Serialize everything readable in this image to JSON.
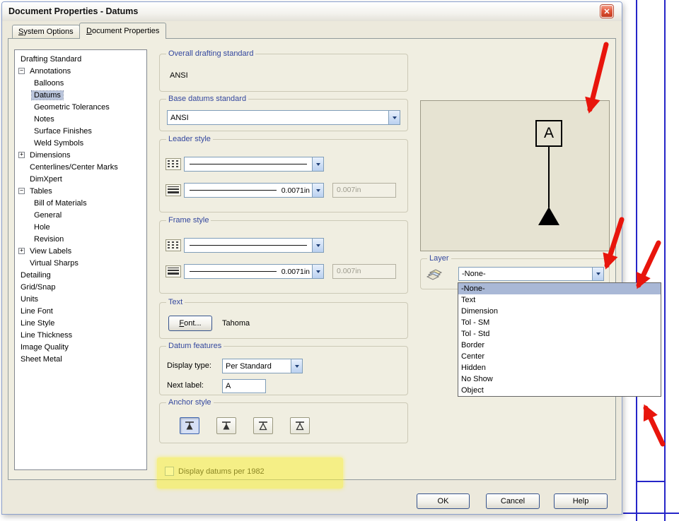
{
  "window": {
    "title": "Document Properties - Datums"
  },
  "icons": {
    "close_glyph": "✕",
    "expander_minus": "−",
    "expander_plus": "+"
  },
  "tabs": [
    {
      "key": "S",
      "rest": "ystem Options"
    },
    {
      "key": "D",
      "rest": "ocument Properties"
    }
  ],
  "tree": {
    "items": [
      {
        "label": "Drafting Standard",
        "level": 0,
        "glyph": "",
        "selected": false
      },
      {
        "label": "Annotations",
        "level": 1,
        "glyph": "minus",
        "selected": false
      },
      {
        "label": "Balloons",
        "level": 2,
        "glyph": "",
        "selected": false
      },
      {
        "label": "Datums",
        "level": 2,
        "glyph": "",
        "selected": true
      },
      {
        "label": "Geometric Tolerances",
        "level": 2,
        "glyph": "",
        "selected": false
      },
      {
        "label": "Notes",
        "level": 2,
        "glyph": "",
        "selected": false
      },
      {
        "label": "Surface Finishes",
        "level": 2,
        "glyph": "",
        "selected": false
      },
      {
        "label": "Weld Symbols",
        "level": 2,
        "glyph": "",
        "selected": false
      },
      {
        "label": "Dimensions",
        "level": 1,
        "glyph": "plus",
        "selected": false
      },
      {
        "label": "Centerlines/Center Marks",
        "level": 1,
        "glyph": "",
        "selected": false
      },
      {
        "label": "DimXpert",
        "level": 1,
        "glyph": "",
        "selected": false
      },
      {
        "label": "Tables",
        "level": 1,
        "glyph": "minus",
        "selected": false
      },
      {
        "label": "Bill of Materials",
        "level": 2,
        "glyph": "",
        "selected": false
      },
      {
        "label": "General",
        "level": 2,
        "glyph": "",
        "selected": false
      },
      {
        "label": "Hole",
        "level": 2,
        "glyph": "",
        "selected": false
      },
      {
        "label": "Revision",
        "level": 2,
        "glyph": "",
        "selected": false
      },
      {
        "label": "View Labels",
        "level": 1,
        "glyph": "plus",
        "selected": false
      },
      {
        "label": "Virtual Sharps",
        "level": 1,
        "glyph": "",
        "selected": false
      },
      {
        "label": "Detailing",
        "level": 0,
        "glyph": "",
        "selected": false
      },
      {
        "label": "Grid/Snap",
        "level": 0,
        "glyph": "",
        "selected": false
      },
      {
        "label": "Units",
        "level": 0,
        "glyph": "",
        "selected": false
      },
      {
        "label": "Line Font",
        "level": 0,
        "glyph": "",
        "selected": false
      },
      {
        "label": "Line Style",
        "level": 0,
        "glyph": "",
        "selected": false
      },
      {
        "label": "Line Thickness",
        "level": 0,
        "glyph": "",
        "selected": false
      },
      {
        "label": "Image Quality",
        "level": 0,
        "glyph": "",
        "selected": false
      },
      {
        "label": "Sheet Metal",
        "level": 0,
        "glyph": "",
        "selected": false
      }
    ]
  },
  "groups": {
    "overall": {
      "title": "Overall drafting standard",
      "value": "ANSI"
    },
    "base": {
      "title": "Base datums standard",
      "value": "ANSI"
    },
    "leader": {
      "title": "Leader style",
      "width_value": "0.0071in",
      "custom_value": "0.007in"
    },
    "frame": {
      "title": "Frame style",
      "width_value": "0.0071in",
      "custom_value": "0.007in"
    },
    "text": {
      "title": "Text",
      "font_key": "F",
      "font_rest": "ont...",
      "font_name": "Tahoma"
    },
    "datum_features": {
      "title": "Datum features",
      "display_label": "Display type:",
      "display_value": "Per Standard",
      "next_label": "Next label:",
      "next_value": "A"
    },
    "anchor": {
      "title": "Anchor style"
    },
    "option_1982": "Display datums per 1982"
  },
  "preview": {
    "letter": "A"
  },
  "layer": {
    "title": "Layer",
    "value": "-None-",
    "selected_index": 0,
    "options": [
      "-None-",
      "Text",
      "Dimension",
      "Tol - SM",
      "Tol - Std",
      "Border",
      "Center",
      "Hidden",
      "No Show",
      "Object"
    ]
  },
  "buttons": {
    "ok": "OK",
    "cancel": "Cancel",
    "help": "Help"
  },
  "colors": {
    "group_title": "#33479E",
    "arrow_red": "#E8150C",
    "highlighter": "#FAF03C",
    "drawing_blue": "#2525C8"
  }
}
